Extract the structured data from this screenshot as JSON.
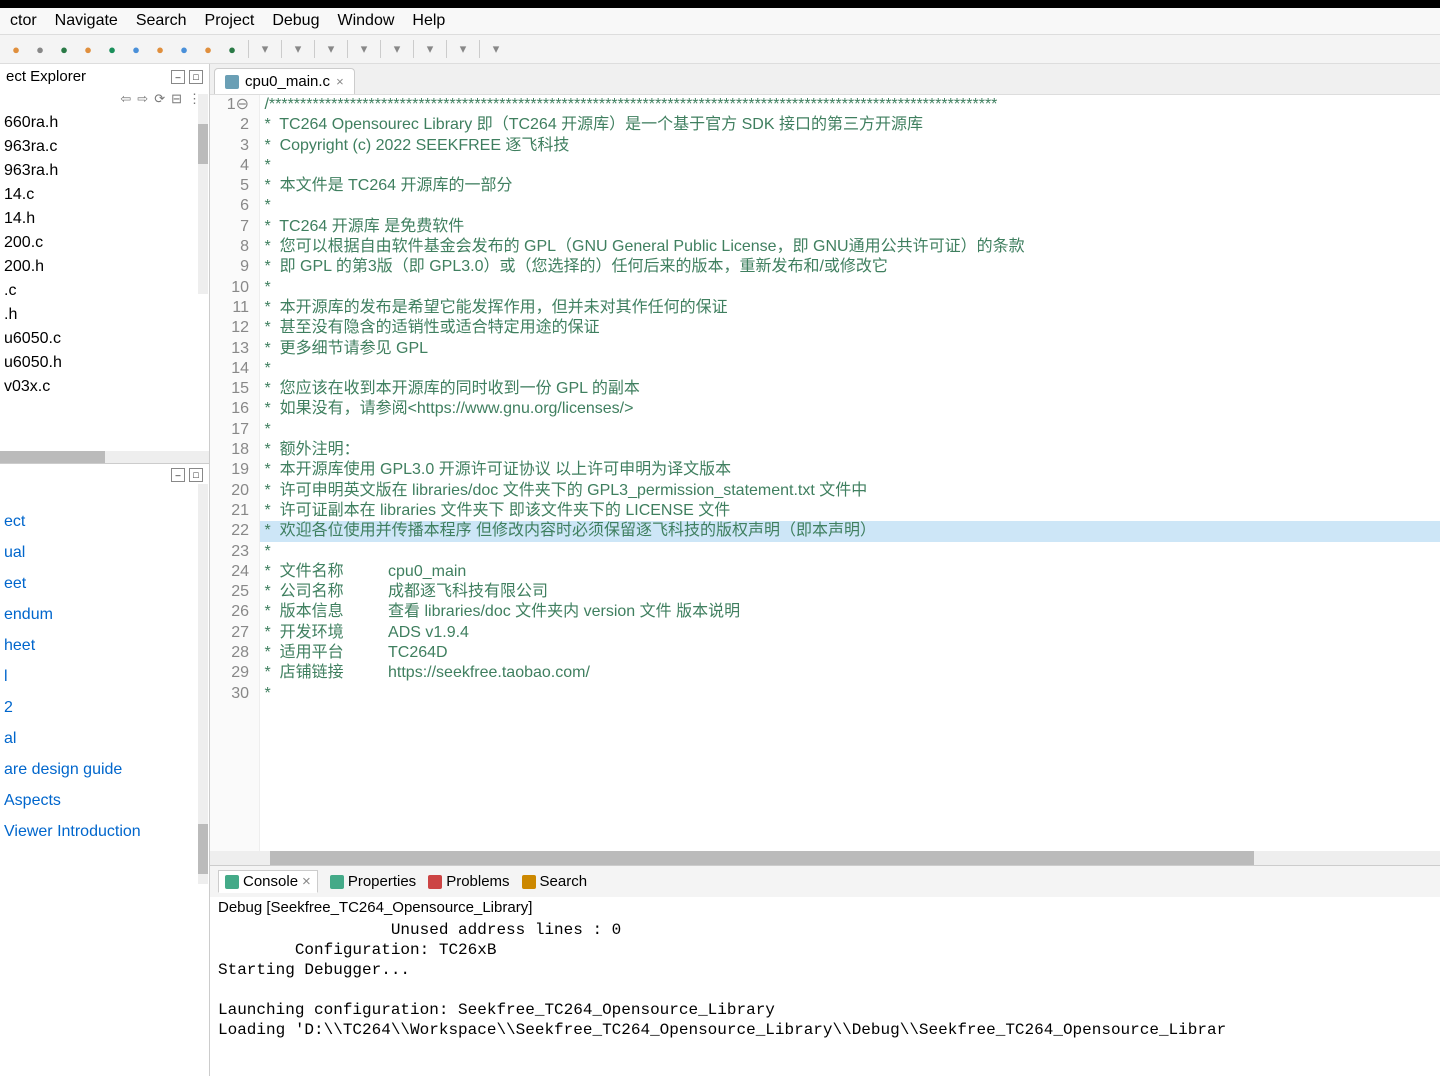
{
  "menu": [
    "ctor",
    "Navigate",
    "Search",
    "Project",
    "Debug",
    "Window",
    "Help"
  ],
  "explorer": {
    "title": "ect Explorer",
    "files": [
      "660ra.h",
      "963ra.c",
      "963ra.h",
      "14.c",
      "14.h",
      "200.c",
      "200.h",
      ".c",
      ".h",
      "u6050.c",
      "u6050.h",
      "v03x.c"
    ]
  },
  "help_items": [
    "ect",
    "ual",
    "eet",
    "endum",
    "heet",
    "l",
    "2",
    "al",
    "are design guide",
    "Aspects",
    "Viewer Introduction"
  ],
  "editor": {
    "tab_name": "cpu0_main.c",
    "highlight_line": 22,
    "lines": [
      "/*********************************************************************************************************************",
      "*  TC264 Opensourec Library 即（TC264 开源库）是一个基于官方 SDK 接口的第三方开源库",
      "*  Copyright (c) 2022 SEEKFREE 逐飞科技",
      "*",
      "*  本文件是 TC264 开源库的一部分",
      "*",
      "*  TC264 开源库 是免费软件",
      "*  您可以根据自由软件基金会发布的 GPL（GNU General Public License，即 GNU通用公共许可证）的条款",
      "*  即 GPL 的第3版（即 GPL3.0）或（您选择的）任何后来的版本，重新发布和/或修改它",
      "*",
      "*  本开源库的发布是希望它能发挥作用，但并未对其作任何的保证",
      "*  甚至没有隐含的适销性或适合特定用途的保证",
      "*  更多细节请参见 GPL",
      "*",
      "*  您应该在收到本开源库的同时收到一份 GPL 的副本",
      "*  如果没有，请参阅<https://www.gnu.org/licenses/>",
      "*",
      "*  额外注明：",
      "*  本开源库使用 GPL3.0 开源许可证协议 以上许可申明为译文版本",
      "*  许可申明英文版在 libraries/doc 文件夹下的 GPL3_permission_statement.txt 文件中",
      "*  许可证副本在 libraries 文件夹下 即该文件夹下的 LICENSE 文件",
      "*  欢迎各位使用并传播本程序 但修改内容时必须保留逐飞科技的版权声明（即本声明）",
      "*",
      "*  文件名称          cpu0_main",
      "*  公司名称          成都逐飞科技有限公司",
      "*  版本信息          查看 libraries/doc 文件夹内 version 文件 版本说明",
      "*  开发环境          ADS v1.9.4",
      "*  适用平台          TC264D",
      "*  店铺链接          https://seekfree.taobao.com/",
      "*"
    ]
  },
  "bottom": {
    "tabs": [
      "Console",
      "Properties",
      "Problems",
      "Search"
    ],
    "active_tab": 0,
    "header": "Debug [Seekfree_TC264_Opensource_Library]",
    "lines": [
      "                  Unused address lines : 0",
      "        Configuration: TC26xB",
      "Starting Debugger...",
      "",
      "Launching configuration: Seekfree_TC264_Opensource_Library",
      "Loading 'D:\\\\TC264\\\\Workspace\\\\Seekfree_TC264_Opensource_Library\\\\Debug\\\\Seekfree_TC264_Opensource_Librar"
    ]
  },
  "toolbar_icons": [
    {
      "name": "home-icon",
      "color": "#e08f3d"
    },
    {
      "name": "back-icon",
      "color": "#888"
    },
    {
      "name": "c-build-icon",
      "color": "#2a7a46"
    },
    {
      "name": "toggle-icon",
      "color": "#e08f3d"
    },
    {
      "name": "refresh-icon",
      "color": "#1a8f5a"
    },
    {
      "name": "help-icon",
      "color": "#4a90d9"
    },
    {
      "name": "circle-icon",
      "color": "#e08f3d"
    },
    {
      "name": "square-icon",
      "color": "#4a90d9"
    },
    {
      "name": "bug-icon",
      "color": "#e08f3d"
    },
    {
      "name": "shield-icon",
      "color": "#2a7a46"
    }
  ]
}
